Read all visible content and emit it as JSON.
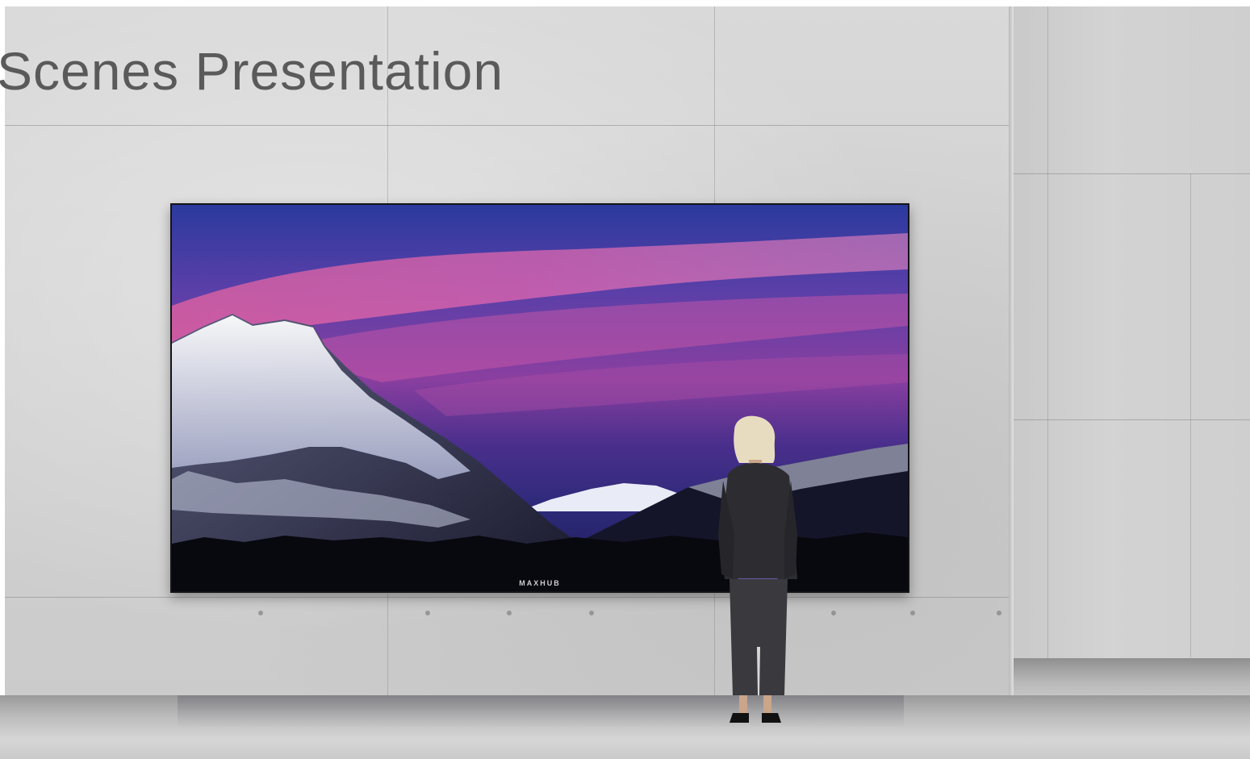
{
  "title": "Scenes Presentation",
  "display": {
    "brand_label": "MAXHUB",
    "content": "mountain-sunset-landscape"
  },
  "colors": {
    "wall": "#d3d3d3",
    "title_text": "#5a5a5a",
    "sky_top": "#2b3a9e",
    "sky_glow": "#e0508a",
    "screen_bezel": "#0b0b10"
  }
}
